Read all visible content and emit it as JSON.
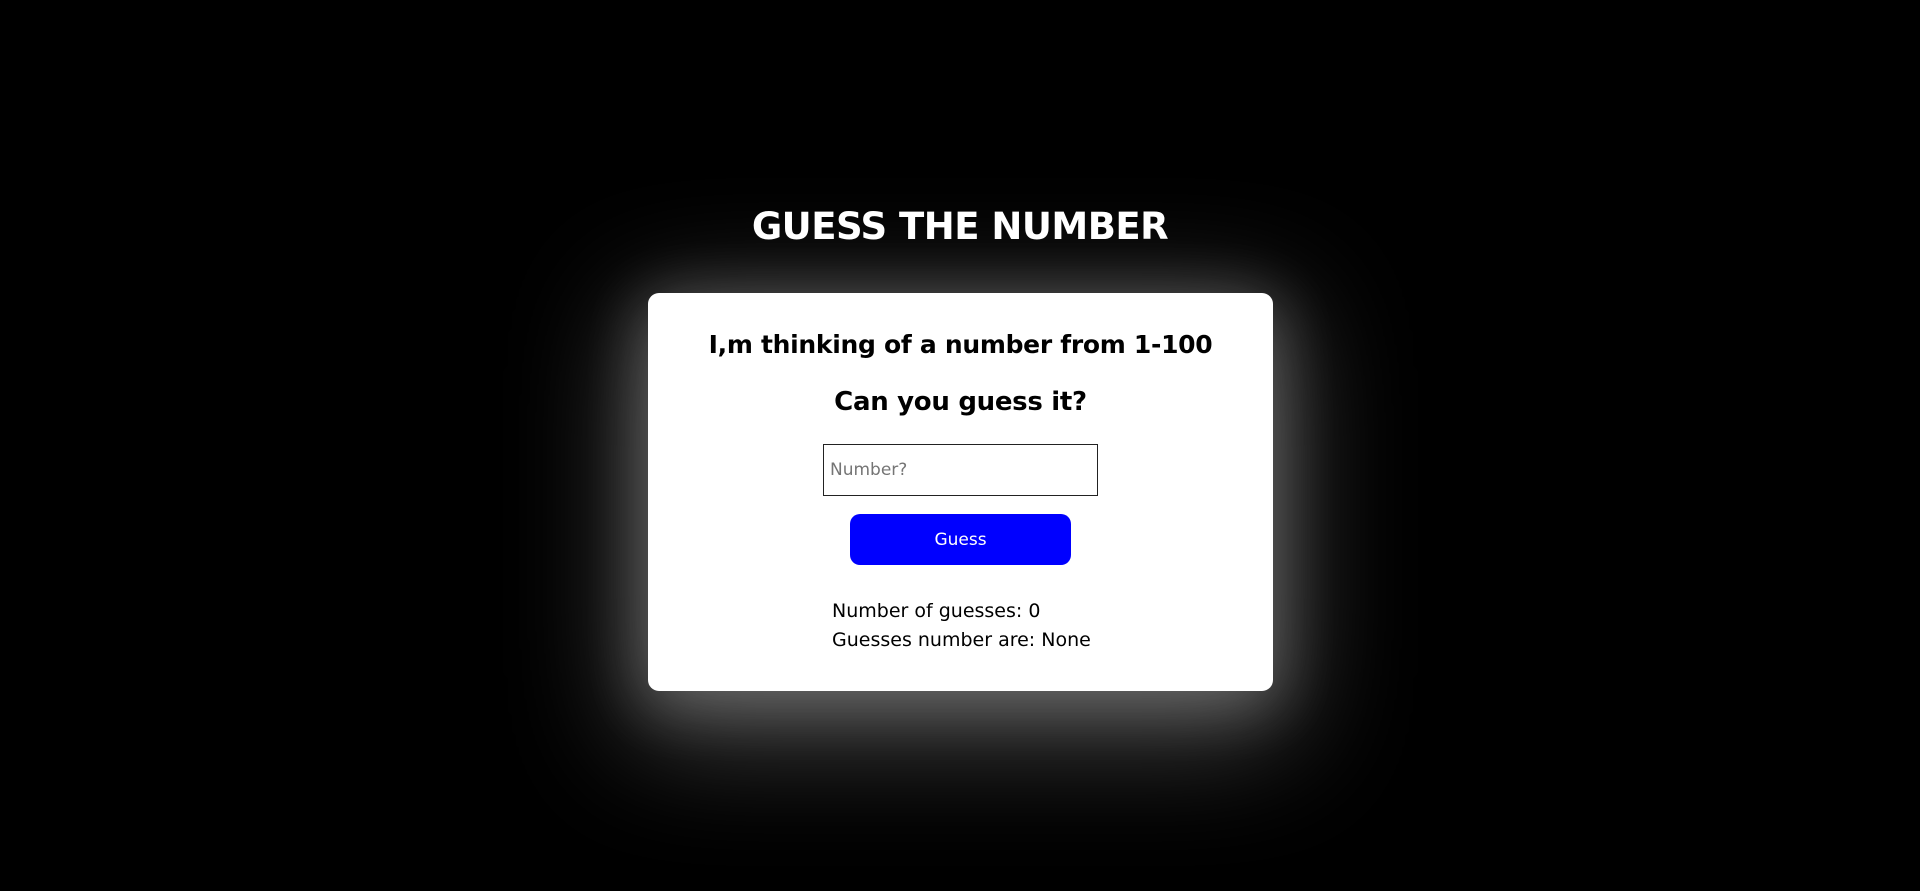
{
  "page": {
    "title": "GUESS THE NUMBER"
  },
  "card": {
    "prompt_line_1": "I,m thinking of a number from 1-100",
    "prompt_line_2": "Can you guess it?",
    "input": {
      "placeholder": "Number?",
      "value": ""
    },
    "guess_button_label": "Guess",
    "stats": {
      "guess_count_label": "Number of guesses:",
      "guess_count_value": "0",
      "guesses_list_label": "Guesses number are:",
      "guesses_list_value": "None"
    }
  },
  "colors": {
    "background": "#000000",
    "card": "#ffffff",
    "button": "#0000ff",
    "button_text": "#ffffff"
  }
}
